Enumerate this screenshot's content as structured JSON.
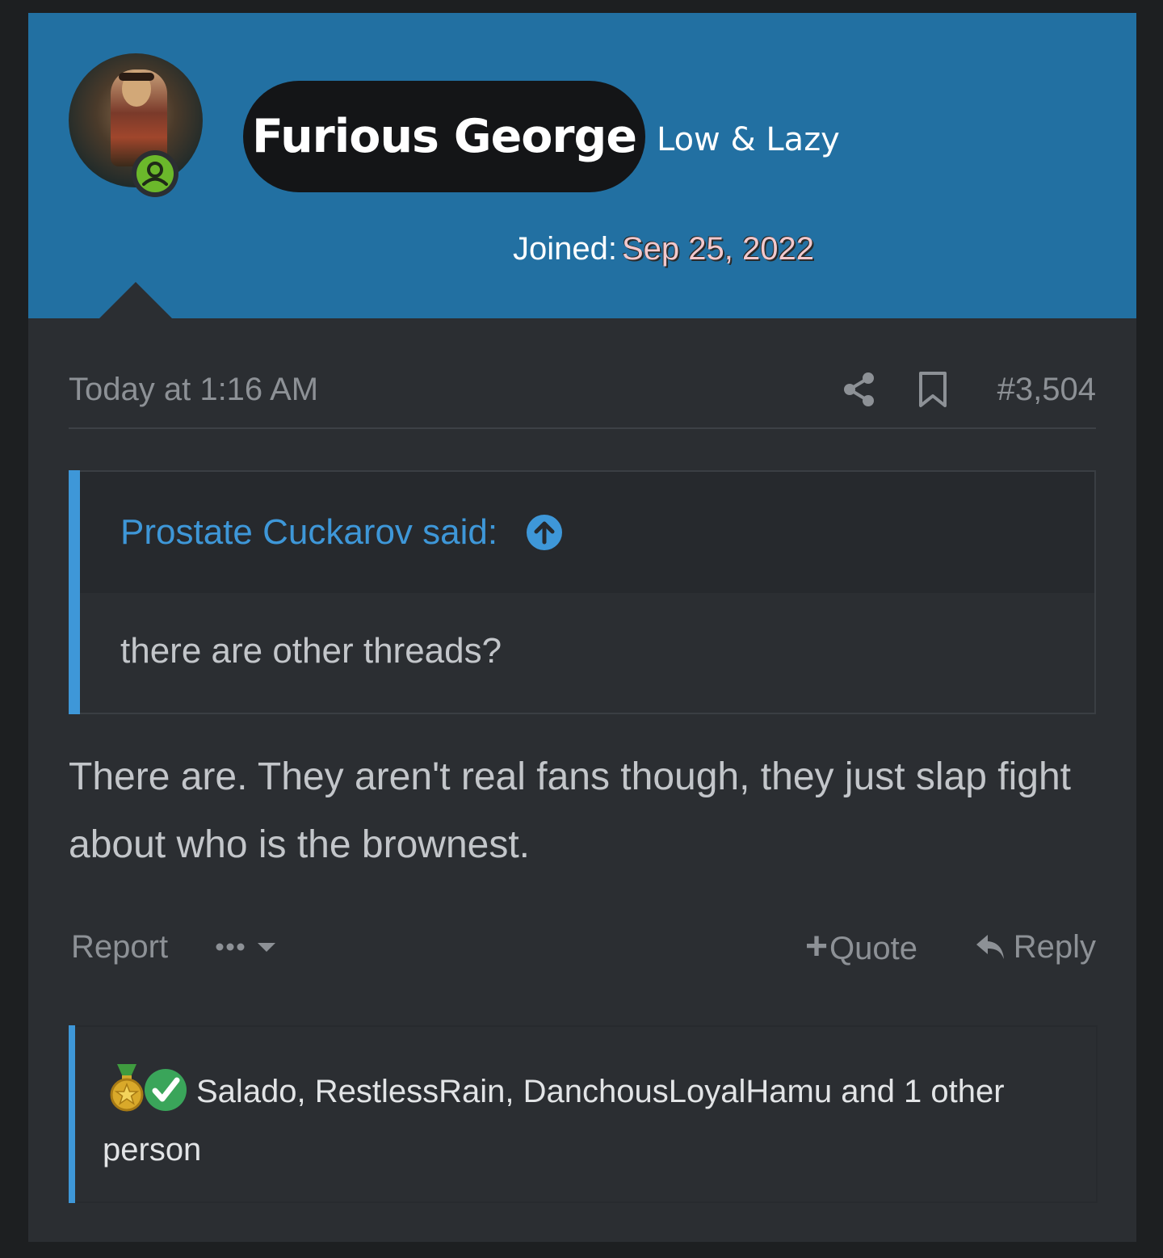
{
  "user": {
    "name": "Furious George",
    "title": "Low & Lazy",
    "joined_label": "Joined:",
    "joined_date": "Sep 25, 2022",
    "avatar_icon": "user-avatar",
    "status_icon": "online-user-icon"
  },
  "post": {
    "time": "Today at 1:16 AM",
    "number": "#3,504",
    "share_icon": "share-icon",
    "bookmark_icon": "bookmark-icon"
  },
  "quote": {
    "author_said": "Prostate Cuckarov said:",
    "jump_icon": "arrow-up-circle-icon",
    "text": "there are other threads?"
  },
  "message": {
    "text": "There are. They aren't real fans though, they just slap fight about who is the brownest."
  },
  "actions": {
    "report": "Report",
    "more_icon": "more-options-icon",
    "quote_plus": "+",
    "quote": "Quote",
    "reply": "Reply"
  },
  "reactions": {
    "icons": [
      "medal-icon",
      "checkmark-icon"
    ],
    "text": "Salado, RestlessRain, DanchousLoyalHamu and 1 other person"
  },
  "colors": {
    "header_bg": "#2270a2",
    "post_bg": "#2b2e32",
    "accent": "#3e97d8",
    "muted_text": "#8d9196",
    "body_text": "#c3c6ca",
    "online": "#6bb82b"
  }
}
